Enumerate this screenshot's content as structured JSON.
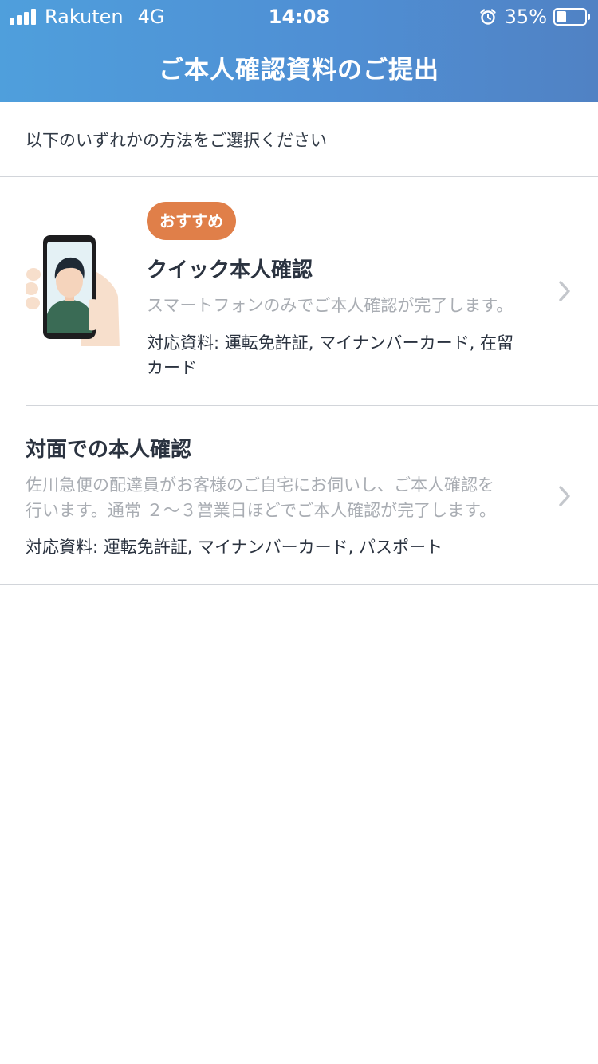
{
  "status_bar": {
    "carrier": "Rakuten",
    "network": "4G",
    "time": "14:08",
    "battery_percent": "35%",
    "battery_level": 0.35,
    "icons": [
      "signal-icon",
      "alarm-icon",
      "battery-icon"
    ]
  },
  "nav": {
    "title": "ご本人確認資料のご提出"
  },
  "instruction": "以下のいずれかの方法をご選択ください",
  "options": [
    {
      "badge": "おすすめ",
      "title": "クイック本人確認",
      "description": "スマートフォンのみでご本人確認が完了します。",
      "documents_line1": "対応資料: 運転免許証, マイナンバーカード, 在留",
      "documents_line2": "カード",
      "illustration": "phone-selfie-illustration",
      "chevron": "chevron-right-icon"
    },
    {
      "title": "対面での本人確認",
      "description_line1": "佐川急便の配達員がお客様のご自宅にお伺いし、ご本人確認を",
      "description_line2": "行います。通常 ２～３営業日ほどでご本人確認が完了します。",
      "documents": "対応資料: 運転免許証, マイナンバーカード, パスポート",
      "chevron": "chevron-right-icon"
    }
  ],
  "colors": {
    "header_gradient_start": "#4f9fdc",
    "header_gradient_end": "#5082c4",
    "badge": "#e07f49",
    "title_text": "#2b3340",
    "muted_text": "#a9adb3",
    "divider": "#d2d5da",
    "chevron": "#c4c7cc"
  }
}
